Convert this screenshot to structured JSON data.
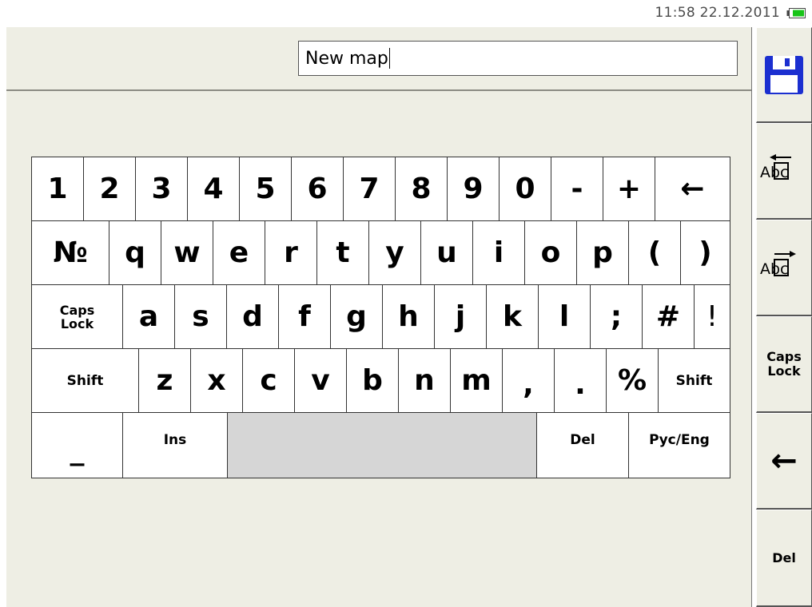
{
  "status": {
    "datetime": "11:58 22.12.2011"
  },
  "title_input": {
    "value": "New map"
  },
  "keyboard": {
    "rows": [
      [
        "1",
        "2",
        "3",
        "4",
        "5",
        "6",
        "7",
        "8",
        "9",
        "0",
        "-",
        "+",
        "←"
      ],
      [
        "№",
        "q",
        "w",
        "e",
        "r",
        "t",
        "y",
        "u",
        "i",
        "o",
        "p",
        "(",
        ")"
      ],
      [
        "Caps\nLock",
        "a",
        "s",
        "d",
        "f",
        "g",
        "h",
        "j",
        "k",
        "l",
        ";",
        "#",
        "!"
      ],
      [
        "Shift",
        "z",
        "x",
        "c",
        "v",
        "b",
        "n",
        "m",
        ",",
        ".",
        "%",
        "Shift"
      ],
      [
        "_",
        "Ins",
        "",
        "Del",
        "Рус/Eng"
      ]
    ]
  },
  "sidebar": {
    "save": "save-icon",
    "cursor_left": "Abc",
    "cursor_right": "Abc",
    "caps_lock": "Caps\nLock",
    "backspace": "←",
    "delete": "Del"
  },
  "colors": {
    "background": "#eeeee4",
    "key": "#ffffff",
    "space_key": "#d6d6d6",
    "save_icon": "#1b2fd0"
  }
}
